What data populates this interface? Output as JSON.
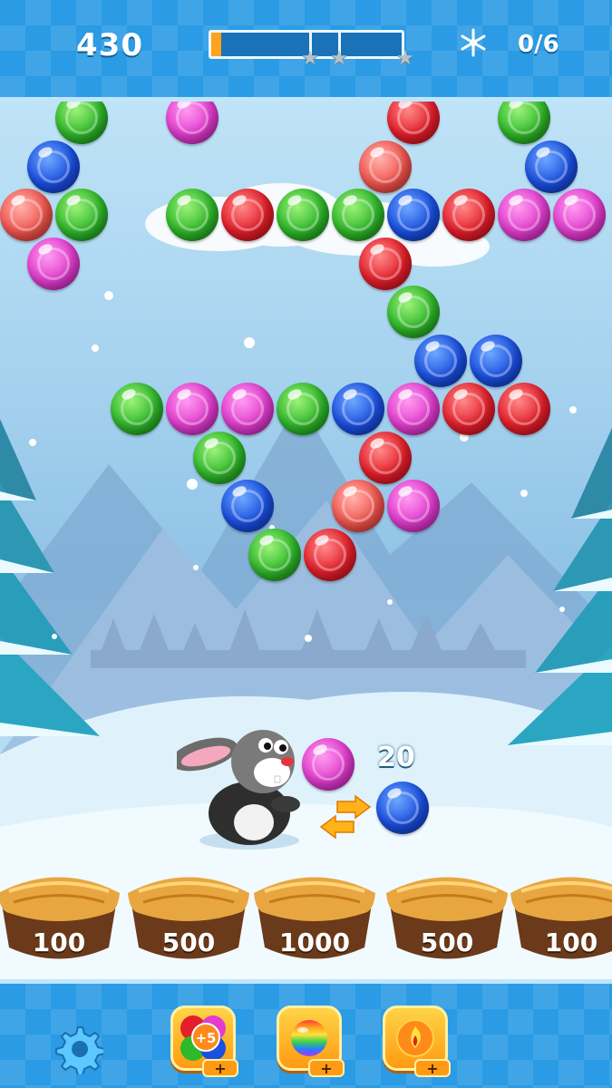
{
  "hud": {
    "score": "430",
    "progress_fraction": 0.05,
    "stars_total": 3,
    "goal_icon": "snowflake-icon",
    "goal_text": "0/6"
  },
  "board": {
    "bubbles": [
      {
        "color": "green",
        "col": 1.5,
        "row": -0.5
      },
      {
        "color": "pink",
        "col": 3.5,
        "row": -0.5
      },
      {
        "color": "red",
        "col": 7.5,
        "row": -0.5
      },
      {
        "color": "green",
        "col": 9.5,
        "row": -0.5
      },
      {
        "color": "blue",
        "col": 1,
        "row": 0.5
      },
      {
        "color": "salmon",
        "col": 7,
        "row": 0.5
      },
      {
        "color": "blue",
        "col": 10,
        "row": 0.5
      },
      {
        "color": "salmon",
        "col": 0.5,
        "row": 1.5
      },
      {
        "color": "green",
        "col": 1.5,
        "row": 1.5
      },
      {
        "color": "green",
        "col": 3.5,
        "row": 1.5
      },
      {
        "color": "red",
        "col": 4.5,
        "row": 1.5
      },
      {
        "color": "green",
        "col": 5.5,
        "row": 1.5
      },
      {
        "color": "green",
        "col": 6.5,
        "row": 1.5
      },
      {
        "color": "blue",
        "col": 7.5,
        "row": 1.5
      },
      {
        "color": "red",
        "col": 8.5,
        "row": 1.5
      },
      {
        "color": "pink",
        "col": 9.5,
        "row": 1.5
      },
      {
        "color": "pink",
        "col": 10.5,
        "row": 1.5
      },
      {
        "color": "pink",
        "col": 1,
        "row": 2.5
      },
      {
        "color": "red",
        "col": 7,
        "row": 2.5
      },
      {
        "color": "green",
        "col": 7.5,
        "row": 3.5
      },
      {
        "color": "blue",
        "col": 8,
        "row": 4.5
      },
      {
        "color": "blue",
        "col": 9,
        "row": 4.5
      },
      {
        "color": "green",
        "col": 2.5,
        "row": 5.5
      },
      {
        "color": "pink",
        "col": 3.5,
        "row": 5.5
      },
      {
        "color": "pink",
        "col": 4.5,
        "row": 5.5
      },
      {
        "color": "green",
        "col": 5.5,
        "row": 5.5
      },
      {
        "color": "blue",
        "col": 6.5,
        "row": 5.5
      },
      {
        "color": "pink",
        "col": 7.5,
        "row": 5.5
      },
      {
        "color": "red",
        "col": 8.5,
        "row": 5.5
      },
      {
        "color": "red",
        "col": 9.5,
        "row": 5.5
      },
      {
        "color": "green",
        "col": 4,
        "row": 6.5
      },
      {
        "color": "red",
        "col": 7,
        "row": 6.5
      },
      {
        "color": "blue",
        "col": 4.5,
        "row": 7.5
      },
      {
        "color": "salmon",
        "col": 6.5,
        "row": 7.5
      },
      {
        "color": "pink",
        "col": 7.5,
        "row": 7.5
      },
      {
        "color": "green",
        "col": 5,
        "row": 8.5
      },
      {
        "color": "red",
        "col": 6,
        "row": 8.5
      }
    ]
  },
  "shooter": {
    "current_bubble": "pink",
    "next_bubble": "blue",
    "points_popup": "20",
    "swap_icon": "swap-arrows-icon",
    "character_icon": "bunny-icon"
  },
  "nests": [
    {
      "label": "100"
    },
    {
      "label": "500"
    },
    {
      "label": "1000"
    },
    {
      "label": "500"
    },
    {
      "label": "100"
    }
  ],
  "toolbar": {
    "settings_icon": "gear-icon",
    "boosters": [
      {
        "name": "extra-bubbles",
        "badge": "+5",
        "add_label": "+"
      },
      {
        "name": "rainbow-bubble",
        "add_label": "+"
      },
      {
        "name": "fire-bubble",
        "add_label": "+"
      }
    ]
  },
  "colors": {
    "blue": "#1a4fe0",
    "red": "#e41e2a",
    "green": "#2fb82a",
    "pink": "#e23ccf",
    "salmon": "#f2554e",
    "accent": "#ffa21c"
  }
}
